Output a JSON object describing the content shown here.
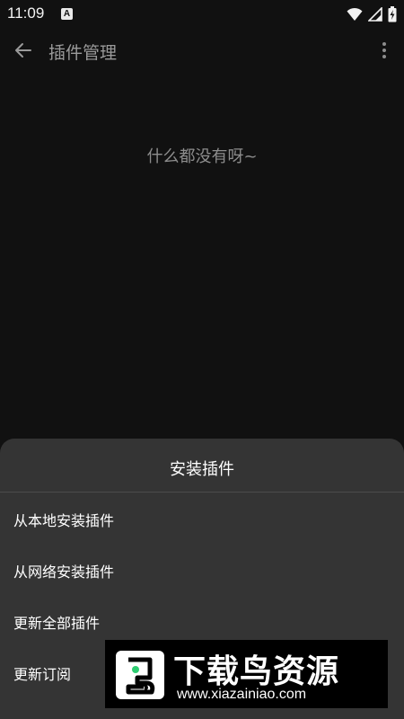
{
  "status_bar": {
    "time": "11:09",
    "notification_icon": "A",
    "icons": [
      "wifi-icon",
      "signal-icon",
      "battery-icon"
    ]
  },
  "toolbar": {
    "back_icon": "arrow-left-icon",
    "title": "插件管理",
    "more_icon": "more-vertical-icon"
  },
  "content": {
    "empty_text": "什么都没有呀~"
  },
  "sheet": {
    "title": "安装插件",
    "items": [
      {
        "label": "从本地安装插件"
      },
      {
        "label": "从网络安装插件"
      },
      {
        "label": "更新全部插件"
      },
      {
        "label": "更新订阅"
      }
    ]
  },
  "watermark": {
    "name": "下载鸟资源",
    "url": "www.xiazainiao.com"
  },
  "colors": {
    "background": "#111111",
    "sheet_background": "#343434",
    "muted_text": "#8d8d8d",
    "logo_accent": "#2ecc71"
  }
}
